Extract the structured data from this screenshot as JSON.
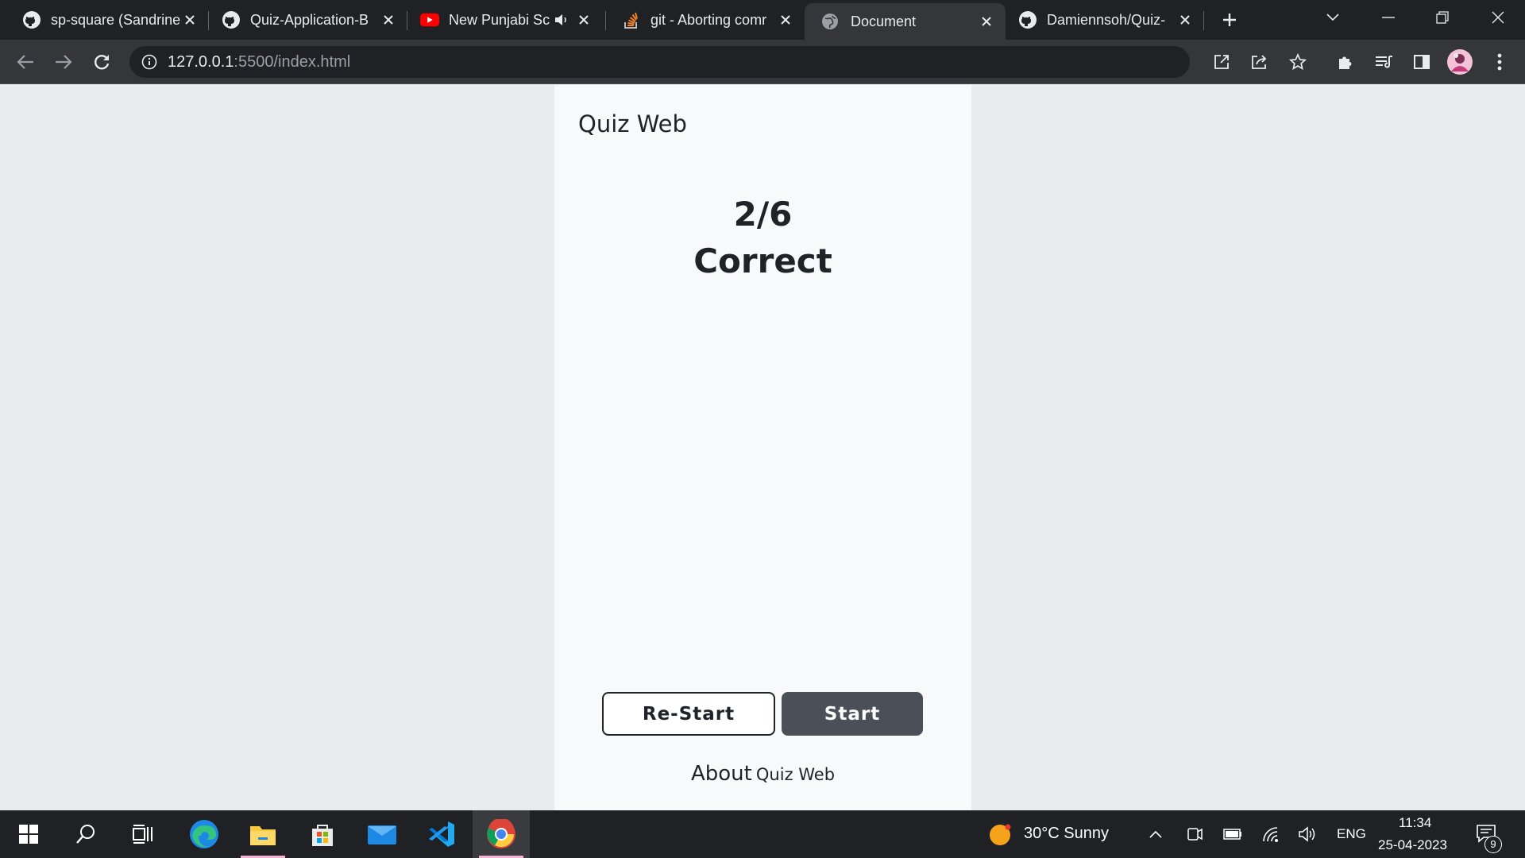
{
  "browser": {
    "tabs": [
      {
        "title": "sp-square (Sandrine",
        "icon": "github-icon"
      },
      {
        "title": "Quiz-Application-B",
        "icon": "github-icon"
      },
      {
        "title": "New Punjabi Sc",
        "icon": "youtube-icon",
        "audio": true
      },
      {
        "title": "git - Aborting comr",
        "icon": "stackoverflow-icon"
      },
      {
        "title": "Document",
        "icon": "globe-icon",
        "active": true
      },
      {
        "title": "Damiennsoh/Quiz-",
        "icon": "github-icon"
      }
    ],
    "address": {
      "host": "127.0.0.1",
      "rest": ":5500/index.html"
    }
  },
  "quiz": {
    "brand": "Quiz Web",
    "score": "2/6",
    "score_label": "Correct",
    "restart_label": "Re-Start",
    "start_label": "Start",
    "about_big": "About",
    "about_small": "Quiz Web"
  },
  "taskbar": {
    "weather": "30°C  Sunny",
    "lang": "ENG",
    "time": "11:34",
    "date": "25-04-2023",
    "notifications": "9"
  },
  "colors": {
    "tabstrip": "#202124",
    "toolbar": "#35363a",
    "page_bg": "#e9ebee",
    "card_bg": "#f8f9fb",
    "start_button": "#4b5058"
  }
}
